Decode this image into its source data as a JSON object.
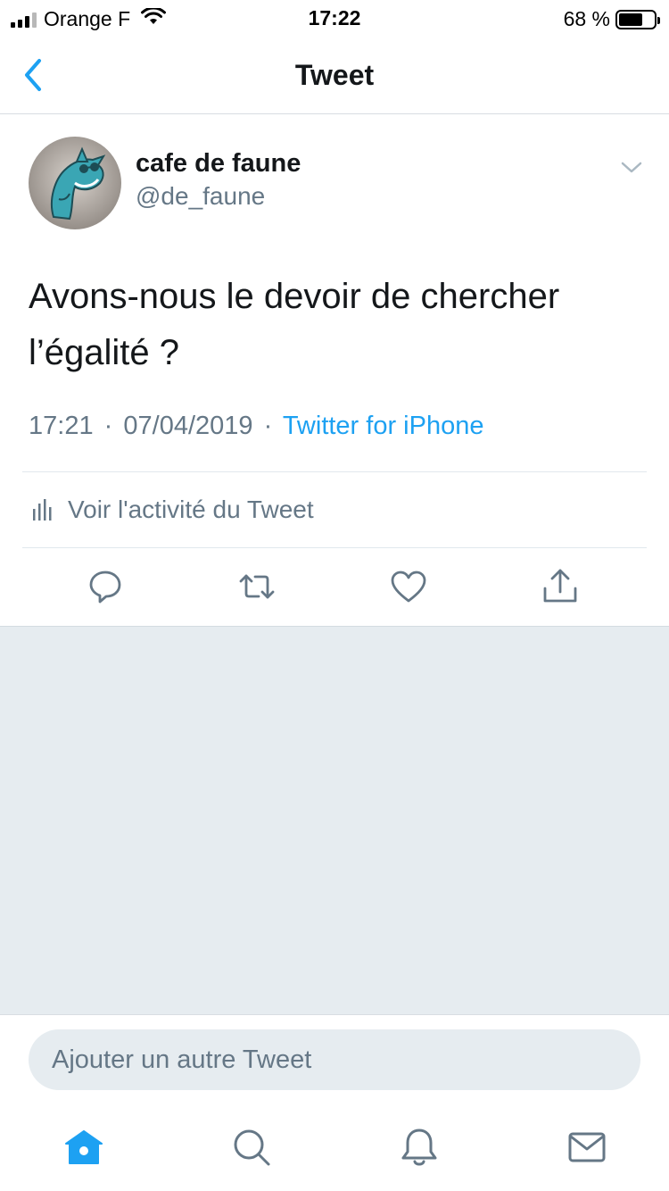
{
  "status_bar": {
    "carrier": "Orange F",
    "time": "17:22",
    "battery_percent": "68 %",
    "battery_level": 0.68,
    "signal_bars": 3
  },
  "nav": {
    "title": "Tweet",
    "back_icon": "chevron-left-icon"
  },
  "tweet": {
    "author_name": "cafe de faune",
    "author_handle": "@de_faune",
    "text": "Avons-nous le devoir de chercher l’égalité ?",
    "time": "17:21",
    "date": "07/04/2019",
    "source": "Twitter for iPhone",
    "separator": "·",
    "activity_label": "Voir l'activité du Tweet",
    "actions": [
      "reply-icon",
      "retweet-icon",
      "like-icon",
      "share-icon"
    ]
  },
  "compose": {
    "placeholder": "Ajouter un autre Tweet"
  },
  "tabs": [
    "home-icon",
    "search-icon",
    "notifications-icon",
    "messages-icon"
  ],
  "colors": {
    "accent": "#1da1f2",
    "secondary_text": "#657786",
    "background_gray": "#e6ecf0"
  }
}
